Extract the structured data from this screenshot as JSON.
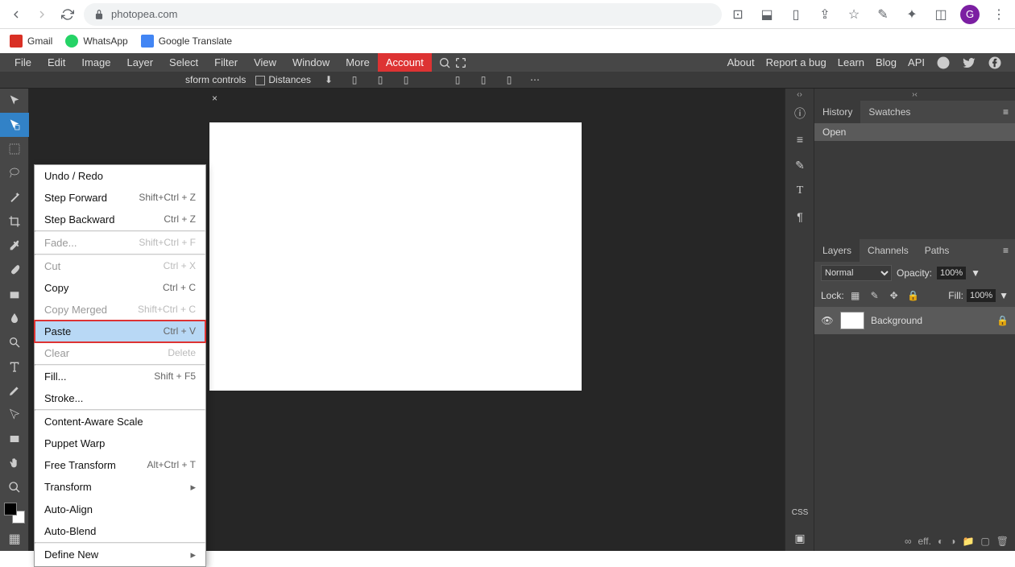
{
  "browser": {
    "url": "photopea.com",
    "avatar_letter": "G",
    "bookmarks": [
      {
        "label": "Gmail",
        "color": "#d93025"
      },
      {
        "label": "WhatsApp",
        "color": "#25d366"
      },
      {
        "label": "Google Translate",
        "color": "#4285f4"
      }
    ]
  },
  "menubar": {
    "items": [
      "File",
      "Edit",
      "Image",
      "Layer",
      "Select",
      "Filter",
      "View",
      "Window",
      "More"
    ],
    "account": "Account",
    "right_links": [
      "About",
      "Report a bug",
      "Learn",
      "Blog",
      "API"
    ]
  },
  "options_bar": {
    "transform_label": "sform controls",
    "distances_label": "Distances"
  },
  "document": {
    "tab_close": "×"
  },
  "edit_menu": [
    {
      "label": "Undo / Redo",
      "shortcut": ""
    },
    {
      "label": "Step Forward",
      "shortcut": "Shift+Ctrl + Z"
    },
    {
      "label": "Step Backward",
      "shortcut": "Ctrl + Z"
    },
    {
      "sep": true
    },
    {
      "label": "Fade...",
      "shortcut": "Shift+Ctrl + F",
      "disabled": true
    },
    {
      "sep": true
    },
    {
      "label": "Cut",
      "shortcut": "Ctrl + X",
      "disabled": true
    },
    {
      "label": "Copy",
      "shortcut": "Ctrl + C"
    },
    {
      "label": "Copy Merged",
      "shortcut": "Shift+Ctrl + C",
      "disabled": true
    },
    {
      "label": "Paste",
      "shortcut": "Ctrl + V",
      "highlight": true
    },
    {
      "label": "Clear",
      "shortcut": "Delete",
      "disabled": true
    },
    {
      "sep": true
    },
    {
      "label": "Fill...",
      "shortcut": "Shift + F5"
    },
    {
      "label": "Stroke...",
      "shortcut": ""
    },
    {
      "sep": true
    },
    {
      "label": "Content-Aware Scale",
      "shortcut": ""
    },
    {
      "label": "Puppet Warp",
      "shortcut": ""
    },
    {
      "label": "Free Transform",
      "shortcut": "Alt+Ctrl + T"
    },
    {
      "label": "Transform",
      "shortcut": "",
      "sub": true
    },
    {
      "label": "Auto-Align",
      "shortcut": ""
    },
    {
      "label": "Auto-Blend",
      "shortcut": ""
    },
    {
      "sep": true
    },
    {
      "label": "Define New",
      "shortcut": "",
      "sub": true
    }
  ],
  "history_panel": {
    "tabs": [
      "History",
      "Swatches"
    ],
    "item": "Open"
  },
  "layers_panel": {
    "tabs": [
      "Layers",
      "Channels",
      "Paths"
    ],
    "blend_mode": "Normal",
    "opacity_label": "Opacity:",
    "opacity_value": "100%",
    "lock_label": "Lock:",
    "fill_label": "Fill:",
    "fill_value": "100%",
    "layer_name": "Background"
  },
  "aux": {
    "css": "CSS"
  }
}
